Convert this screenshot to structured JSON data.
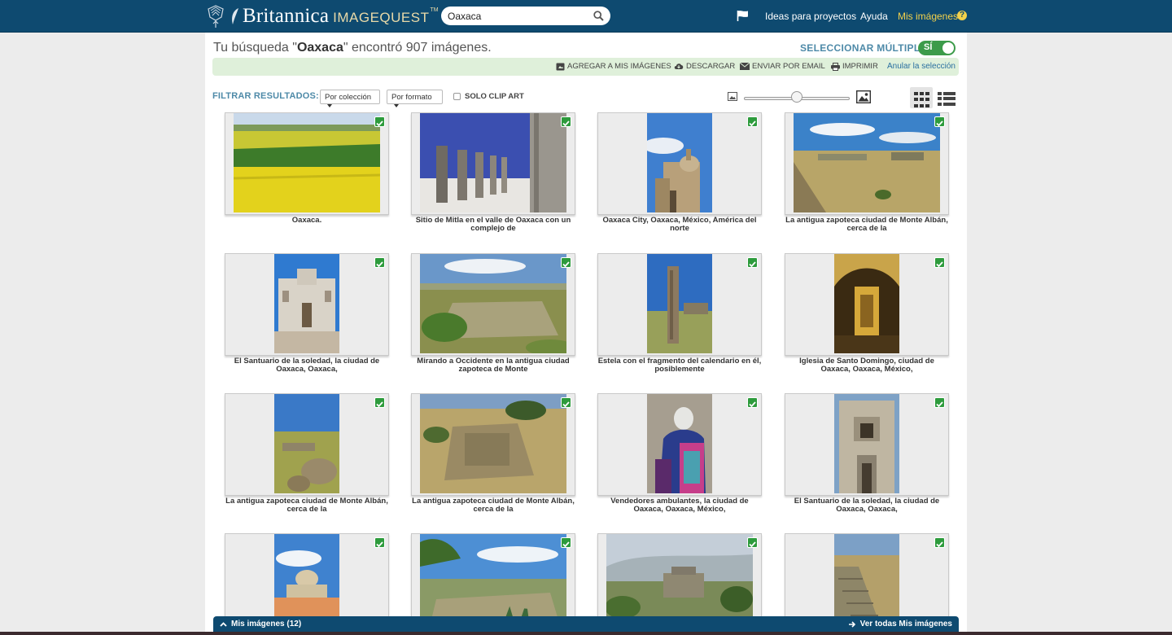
{
  "header": {
    "brand": "Britannica",
    "product": "IMAGEQUEST",
    "tm": "TM",
    "search_value": "Oaxaca",
    "nav": {
      "ideas": "Ideas para proyectos",
      "help": "Ayuda",
      "mine": "Mis imágenes",
      "help_mark": "?"
    }
  },
  "results": {
    "prefix": "Tu búsqueda \"",
    "query": "Oaxaca",
    "suffix": "\" encontró 907 imágenes.",
    "multi_label": "SELECCIONAR MÚLTIPLES",
    "toggle_label": "SÍ"
  },
  "actions": {
    "add": "AGREGAR A MIS IMÁGENES",
    "download": "DESCARGAR",
    "email": "ENVIAR POR EMAIL",
    "print": "IMPRIMIR",
    "cancel": "Anular la selección"
  },
  "filters": {
    "label": "FILTRAR RESULTADOS:",
    "collection": "Por colección",
    "format": "Por formato",
    "clipart": "SOLO CLIP ART"
  },
  "zoom_fraction": 0.5,
  "images": [
    {
      "caption": "Oaxaca.",
      "kind": "landscape",
      "scene": "fields"
    },
    {
      "caption": "Sitio de Mitla en el valle de Oaxaca con un complejo de",
      "kind": "landscape",
      "scene": "columns"
    },
    {
      "caption": "Oaxaca City, Oaxaca, México, América del norte",
      "kind": "portrait",
      "scene": "church-sky"
    },
    {
      "caption": "La antigua zapoteca ciudad de Monte Albán, cerca de la",
      "kind": "landscape",
      "scene": "plaza"
    },
    {
      "caption": "El Santuario de la soledad, la ciudad de Oaxaca, Oaxaca,",
      "kind": "portrait",
      "scene": "white-church"
    },
    {
      "caption": "Mirando a Occidente en la antigua ciudad zapoteca de Monte",
      "kind": "landscape",
      "scene": "ruins-green"
    },
    {
      "caption": "Estela con el fragmento del calendario en él, posiblemente",
      "kind": "portrait",
      "scene": "stela"
    },
    {
      "caption": "Iglesia de Santo Domingo, ciudad de Oaxaca, Oaxaca, México,",
      "kind": "portrait",
      "scene": "gold-interior"
    },
    {
      "caption": "La antigua zapoteca ciudad de Monte Albán, cerca de la",
      "kind": "portrait",
      "scene": "stones-grass"
    },
    {
      "caption": "La antigua zapoteca ciudad de Monte Albán, cerca de la",
      "kind": "landscape",
      "scene": "pyramid"
    },
    {
      "caption": "Vendedores ambulantes, la ciudad de Oaxaca, Oaxaca, México,",
      "kind": "portrait",
      "scene": "vendor"
    },
    {
      "caption": "El Santuario de la soledad, la ciudad de Oaxaca, Oaxaca,",
      "kind": "portrait",
      "scene": "facade"
    },
    {
      "caption": "",
      "kind": "portrait",
      "scene": "dome-orange"
    },
    {
      "caption": "",
      "kind": "landscape",
      "scene": "valley-agave"
    },
    {
      "caption": "",
      "kind": "landscape",
      "scene": "hazy-ruins"
    },
    {
      "caption": "",
      "kind": "portrait",
      "scene": "steps"
    }
  ],
  "bottom": {
    "mine": "Mis imágenes (12)",
    "view_all": "Ver todas Mis imágenes"
  }
}
